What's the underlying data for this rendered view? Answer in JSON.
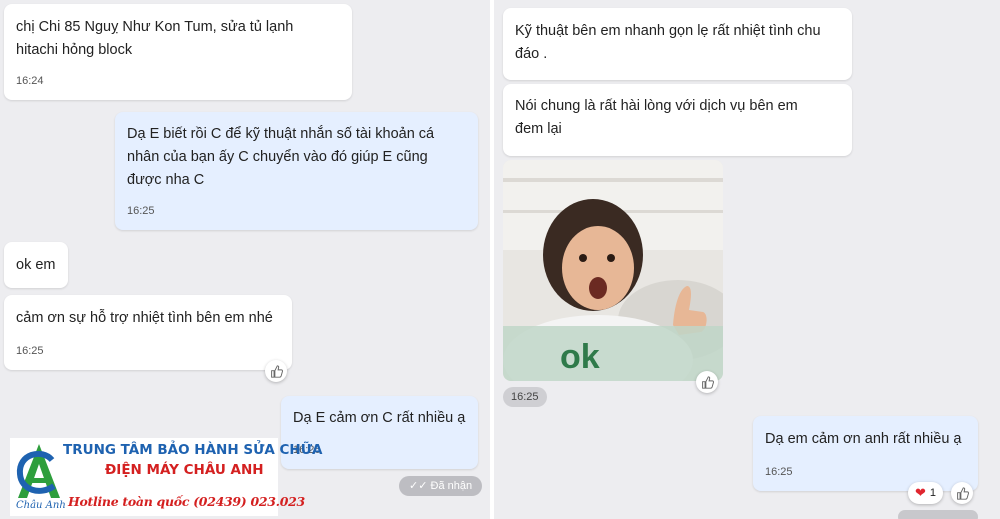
{
  "left": {
    "messages": [
      {
        "text": "chị Chi 85 Nguỵ Như Kon Tum, sửa tủ lạnh\nhitachi hỏng block",
        "time": "16:24"
      },
      {
        "text": "Dạ E biết rồi C để kỹ thuật nhắn số tài khoản cá\nnhân của bạn ấy C chuyển vào đó giúp E cũng\nđược nha C",
        "time": "16:25"
      },
      {
        "text": "ok em"
      },
      {
        "text": "cảm ơn sự hỗ trợ nhiệt tình bên em nhé",
        "time": "16:25"
      },
      {
        "text": "Dạ E cảm ơn C rất nhiều ạ",
        "time": "16:26"
      }
    ],
    "delivered_status": "Đã nhận"
  },
  "banner": {
    "line1": "TRUNG TÂM BẢO HÀNH SỬA CHỮA",
    "line2": "ĐIỆN MÁY CHÂU ANH",
    "hotline": "Hotline toàn quốc (02439) 023.023",
    "logo_caption": "Châu Anh",
    "colors": {
      "brand_blue": "#1e62b0",
      "brand_red": "#d42020",
      "brand_green": "#2e9e3c"
    }
  },
  "right": {
    "messages": [
      {
        "text": "Kỹ thuật bên em nhanh gọn lẹ rất nhiệt tình chu\nđáo ."
      },
      {
        "text": "Nói chung là rất hài lòng với dịch vụ bên em\nđem lại"
      },
      {
        "text": "Dạ em cảm ơn anh rất nhiều ạ",
        "time": "16:25"
      }
    ],
    "image": {
      "caption": "ok",
      "time": "16:25"
    },
    "reaction_count": "1"
  }
}
